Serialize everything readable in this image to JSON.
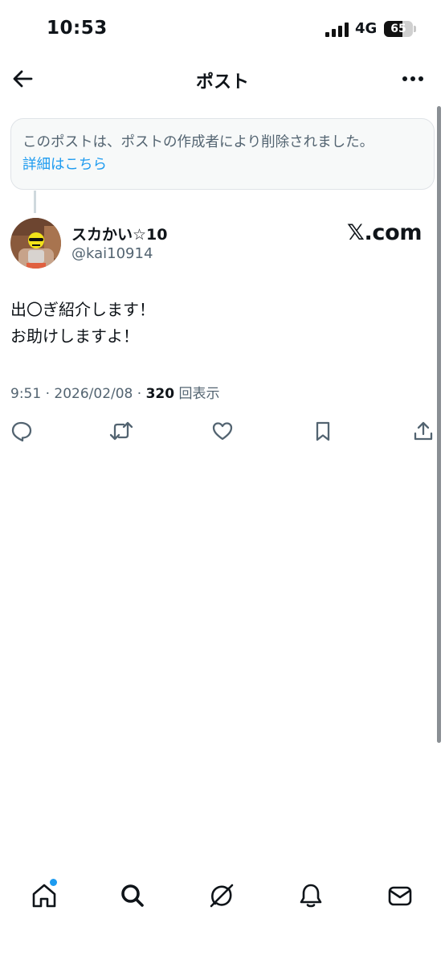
{
  "status_bar": {
    "time": "10:53",
    "network": "4G",
    "battery": "65",
    "battery_level": 0.65
  },
  "header": {
    "title": "ポスト"
  },
  "notice": {
    "text": "このポストは、ポストの作成者により削除されました。",
    "link": "詳細はこちら"
  },
  "post": {
    "author_name": "スカかい☆10",
    "author_handle": "@kai10914",
    "source_badge": "𝕏.com",
    "text_lines": [
      "出〇ぎ紹介します！",
      "お助けしますよ！"
    ],
    "meta_prefix": "9:51 · 2026/02/08 · ",
    "views": "320",
    "views_label": " 回表示"
  },
  "actions": [
    "reply-icon",
    "repost-icon",
    "like-icon",
    "bookmark-icon",
    "share-icon"
  ],
  "bottom_nav": [
    "home-icon",
    "search-icon",
    "grok-icon",
    "notifications-icon",
    "messages-icon"
  ],
  "colors": {
    "accent": "#1d9bf0",
    "text": "#0f1419",
    "secondary": "#536471",
    "notice_bg": "#f7f9f9",
    "border": "#dfe3e7"
  }
}
